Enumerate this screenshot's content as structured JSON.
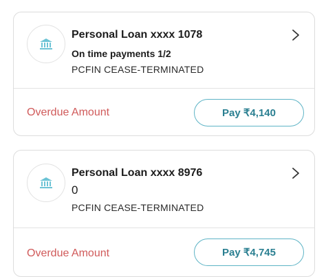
{
  "loans": [
    {
      "title": "Personal Loan xxxx 1078",
      "subtitle": "On time payments 1/2",
      "status": "PCFIN CEASE-TERMINATED",
      "overdue_label": "Overdue Amount",
      "pay_label": "Pay ₹4,140",
      "icon": "bank-icon"
    },
    {
      "title": "Personal Loan xxxx 8976",
      "subtitle": "0",
      "status": "PCFIN CEASE-TERMINATED",
      "overdue_label": "Overdue Amount",
      "pay_label": "Pay ₹4,745",
      "icon": "bank-icon"
    }
  ],
  "colors": {
    "overdue": "#d05a5a",
    "pay_border": "#5cb3c5",
    "pay_text": "#2a7f91",
    "icon": "#6cc3d5"
  }
}
